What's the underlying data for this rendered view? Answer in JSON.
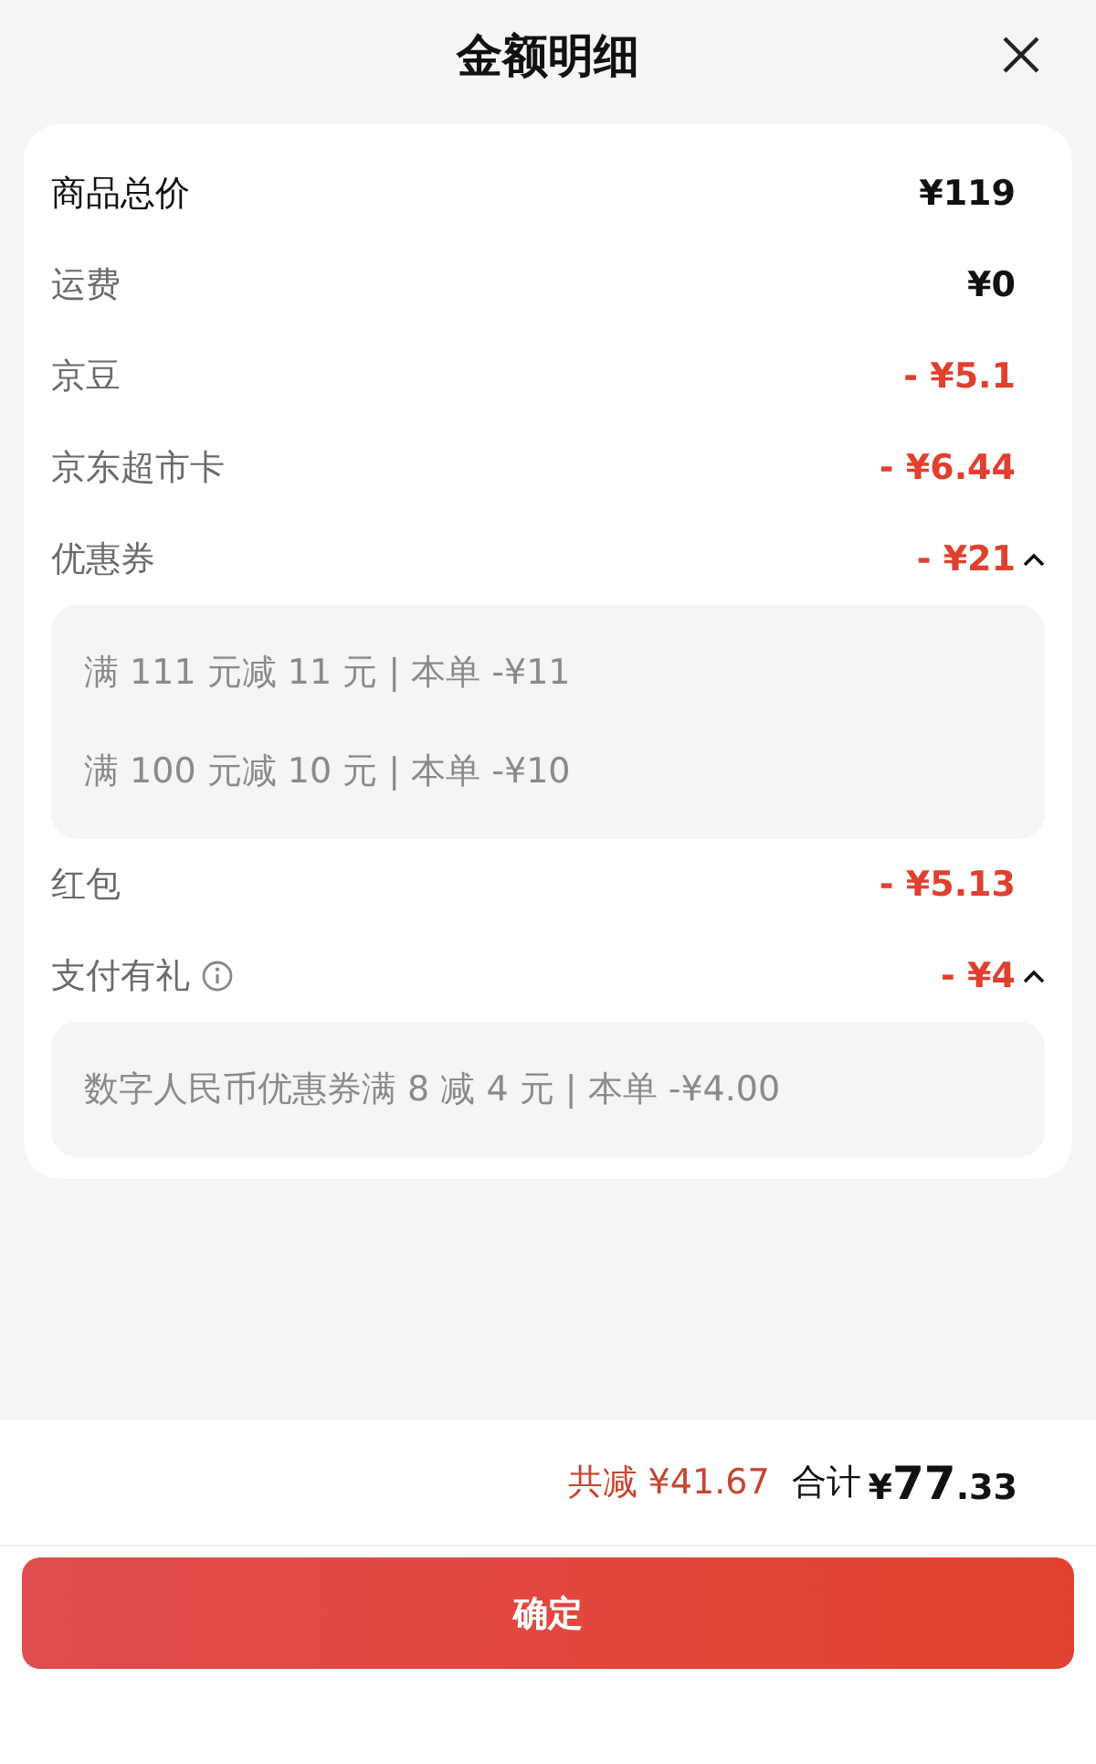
{
  "header": {
    "title": "金额明细"
  },
  "rows": [
    {
      "label": "商品总价",
      "amount": "¥119",
      "kind": "total",
      "info": false,
      "expanded": false
    },
    {
      "label": "运费",
      "amount": "¥0",
      "kind": "plain",
      "info": false,
      "expanded": false
    },
    {
      "label": "京豆",
      "amount": "- ¥5.1",
      "kind": "discount",
      "info": false,
      "expanded": false
    },
    {
      "label": "京东超市卡",
      "amount": "- ¥6.44",
      "kind": "discount",
      "info": false,
      "expanded": false
    },
    {
      "label": "优惠券",
      "amount": "- ¥21",
      "kind": "discount",
      "info": false,
      "expanded": true,
      "details": [
        "满 111 元减 11 元 | 本单 -¥11",
        "满 100 元减 10 元 | 本单 -¥10"
      ]
    },
    {
      "label": "红包",
      "amount": "- ¥5.13",
      "kind": "discount",
      "info": false,
      "expanded": false
    },
    {
      "label": "支付有礼",
      "amount": "- ¥4",
      "kind": "discount",
      "info": true,
      "expanded": true,
      "details": [
        "数字人民币优惠券满 8 减 4 元 | 本单 -¥4.00"
      ]
    }
  ],
  "summary": {
    "saved": "共减 ¥41.67",
    "total_label": "合计",
    "total_currency": "¥",
    "total_integer": "77",
    "total_decimal": ".33"
  },
  "confirm_button": "确定"
}
